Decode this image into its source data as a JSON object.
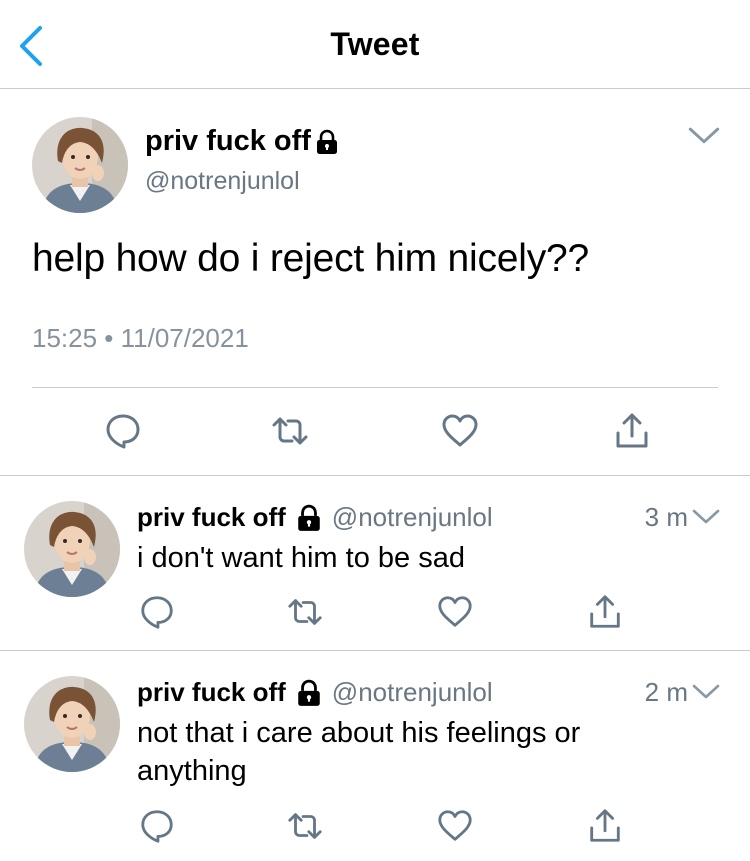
{
  "header": {
    "title": "Tweet"
  },
  "main_tweet": {
    "display_name": "priv fuck off",
    "handle": "@notrenjunlol",
    "text": "help how do i reject him nicely??",
    "timestamp": "15:25 • 11/07/2021"
  },
  "replies": [
    {
      "display_name": "priv fuck off",
      "handle": "@notrenjunlol",
      "time": "3 m",
      "text": "i don't want him to be sad"
    },
    {
      "display_name": "priv fuck off",
      "handle": "@notrenjunlol",
      "time": "2 m",
      "text": "not that i care about his feelings or anything"
    }
  ],
  "icons": {
    "back": "chevron-left-icon",
    "lock": "lock-icon",
    "caret": "chevron-down-icon",
    "reply": "comment-icon",
    "retweet": "retweet-icon",
    "like": "heart-icon",
    "share": "share-icon"
  },
  "colors": {
    "accent": "#1da1f2",
    "icon_gray": "#657786",
    "secondary_text": "#6a7782",
    "divider": "#c8ccd0"
  }
}
